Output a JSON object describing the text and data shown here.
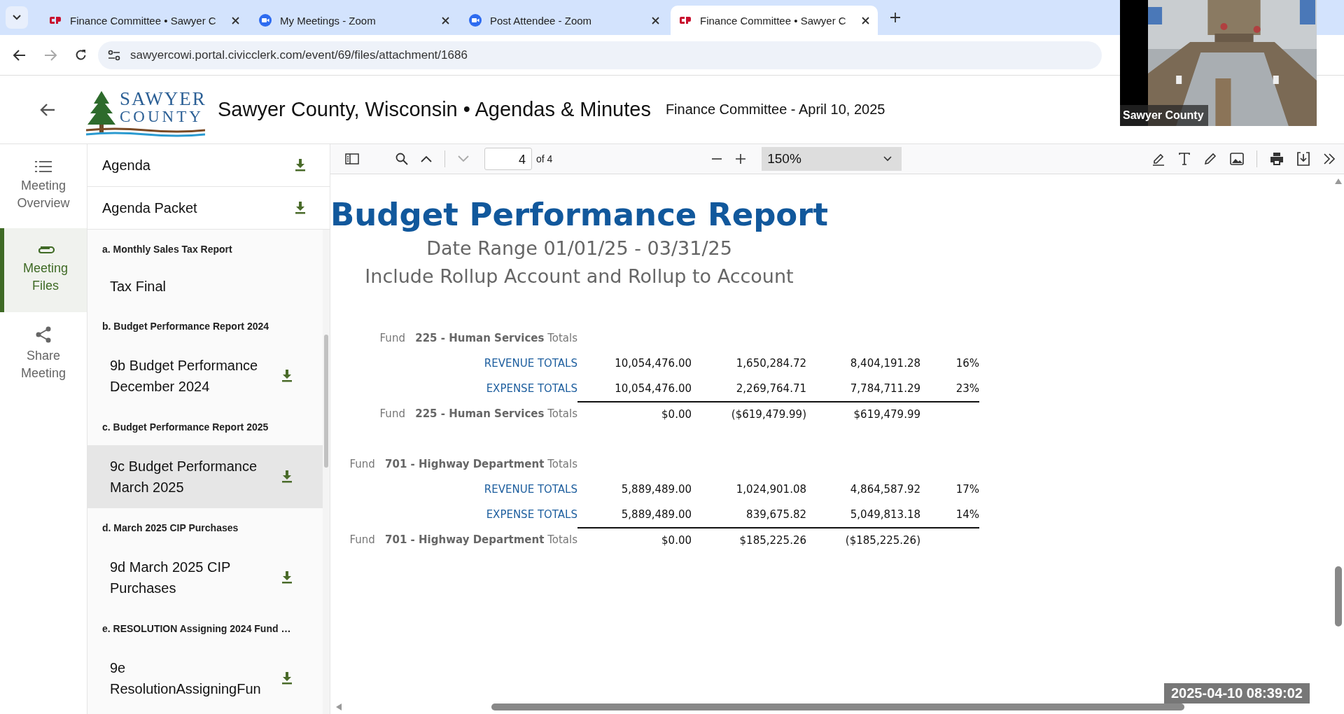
{
  "browser": {
    "tabs": [
      {
        "title": "Finance Committee • Sawyer C",
        "kind": "civicclerk",
        "selected": false
      },
      {
        "title": "My Meetings - Zoom",
        "kind": "zoom",
        "selected": false
      },
      {
        "title": "Post Attendee - Zoom",
        "kind": "zoom",
        "selected": false
      },
      {
        "title": "Finance Committee • Sawyer C",
        "kind": "civicclerk",
        "selected": true
      }
    ],
    "url": "sawyercowi.portal.civicclerk.com/event/69/files/attachment/1686"
  },
  "header": {
    "logo": {
      "line1": "SAWYER",
      "line2": "COUNTY"
    },
    "title": "Sawyer County, Wisconsin • Agendas & Minutes",
    "meeting": "Finance Committee - April 10, 2025"
  },
  "nav": [
    {
      "label": "Meeting Overview",
      "kind": "list",
      "selected": false
    },
    {
      "label": "Meeting Files",
      "kind": "paperclip",
      "selected": true
    },
    {
      "label": "Share Meeting",
      "kind": "share",
      "selected": false
    }
  ],
  "files": {
    "top": [
      "Agenda",
      "Agenda Packet"
    ],
    "sections": [
      {
        "heading": "a. Monthly Sales Tax Report",
        "items": [
          {
            "label": "Tax Final",
            "selected": false
          }
        ]
      },
      {
        "heading": "b. Budget Performance Report 2024",
        "items": [
          {
            "label": "9b Budget Performance December 2024",
            "selected": false
          }
        ]
      },
      {
        "heading": "c. Budget Performance Report 2025",
        "items": [
          {
            "label": "9c Budget Performance March 2025",
            "selected": true
          }
        ]
      },
      {
        "heading": "d. March 2025 CIP Purchases",
        "items": [
          {
            "label": "9d March 2025 CIP Purchases",
            "selected": false
          }
        ]
      },
      {
        "heading": "e. RESOLUTION Assigning 2024 Fund …",
        "items": [
          {
            "label": "9e ResolutionAssigningFun",
            "selected": false
          }
        ]
      }
    ]
  },
  "viewer": {
    "page": "4",
    "page_count": "of 4",
    "zoom": "150%"
  },
  "report": {
    "title": "Budget Performance Report",
    "subtitle": "Date Range 01/01/25 - 03/31/25",
    "filter": "Include Rollup Account and Rollup to Account",
    "funds": [
      {
        "label": "Fund   **225 - Human Services** Totals",
        "rows": [
          {
            "label": "REVENUE TOTALS",
            "values": [
              "10,054,476.00",
              "1,650,284.72",
              "8,404,191.28",
              "16%"
            ]
          },
          {
            "label": "EXPENSE TOTALS",
            "values": [
              "10,054,476.00",
              "2,269,764.71",
              "7,784,711.29",
              "23%"
            ]
          }
        ],
        "total": {
          "label": "Fund   **225 - Human Services** Totals",
          "values": [
            "$0.00",
            "($619,479.99)",
            "$619,479.99"
          ]
        }
      },
      {
        "label": "Fund   **701 - Highway Department** Totals",
        "rows": [
          {
            "label": "REVENUE TOTALS",
            "values": [
              "5,889,489.00",
              "1,024,901.08",
              "4,864,587.92",
              "17%"
            ]
          },
          {
            "label": "EXPENSE TOTALS",
            "values": [
              "5,889,489.00",
              "839,675.82",
              "5,049,813.18",
              "14%"
            ]
          }
        ],
        "total": {
          "label": "Fund   **701 - Highway Department** Totals",
          "values": [
            "$0.00",
            "$185,225.26",
            "($185,225.26)"
          ]
        }
      }
    ]
  },
  "video": {
    "caption": "Sawyer County",
    "timestamp": "2025-04-10 08:39:02"
  }
}
